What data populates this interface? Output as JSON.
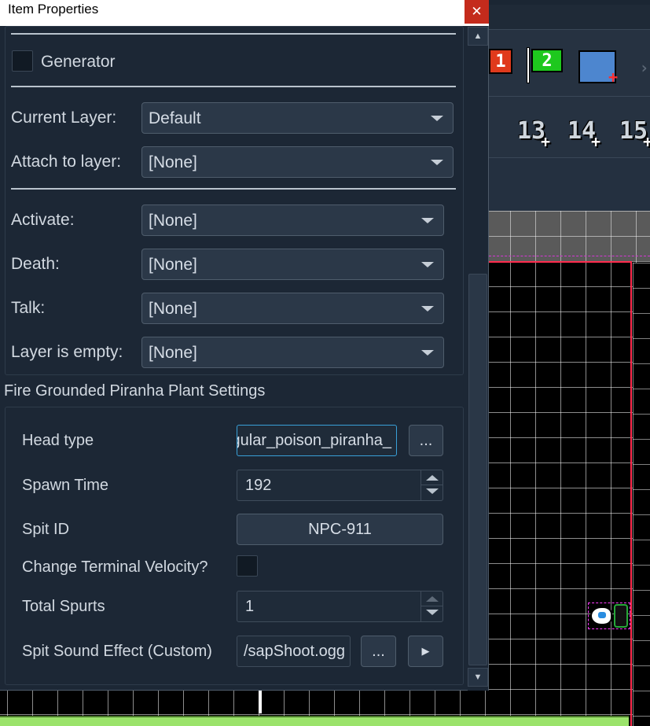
{
  "dialog": {
    "title": "Item Properties",
    "close_glyph": "✕"
  },
  "generator": {
    "label": "Generator",
    "checked": false
  },
  "layers": {
    "current_label": "Current Layer:",
    "current_value": "Default",
    "attach_label": "Attach to layer:",
    "attach_value": "[None]"
  },
  "events": {
    "activate_label": "Activate:",
    "activate_value": "[None]",
    "death_label": "Death:",
    "death_value": "[None]",
    "talk_label": "Talk:",
    "talk_value": "[None]",
    "empty_label": "Layer is empty:",
    "empty_value": "[None]"
  },
  "settings": {
    "section_title": "Fire Grounded Piranha Plant Settings",
    "head_type_label": "Head type",
    "head_type_value": "gular_poison_piranha_",
    "browse_label": "...",
    "spawn_time_label": "Spawn Time",
    "spawn_time_value": "192",
    "spit_id_label": "Spit ID",
    "spit_id_value": "NPC-911",
    "terminal_velocity_label": "Change Terminal Velocity?",
    "terminal_velocity_checked": false,
    "total_spurts_label": "Total Spurts",
    "total_spurts_value": "1",
    "sound_label": "Spit Sound Effect (Custom)",
    "sound_value": "/sapShoot.ogg",
    "sound_browse_label": "...",
    "play_glyph": "▶"
  },
  "editor": {
    "flag1_label": "1",
    "flag2_label": "2",
    "layer_numbers": [
      "13",
      "14",
      "15"
    ],
    "chevron_glyph": "›",
    "plus_glyph": "+"
  }
}
